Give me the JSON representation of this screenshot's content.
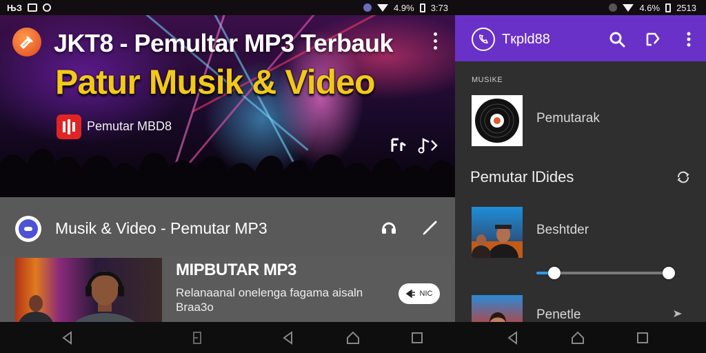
{
  "status_left": {
    "left_icons": [
      "sim-icon",
      "notification-icon",
      "media-icon"
    ],
    "left_text": "ЊЗ",
    "battery": "4.9%",
    "time": "3:73"
  },
  "status_right": {
    "battery": "4.6%",
    "time": "2513"
  },
  "banner": {
    "title": "JKT8 - Pemultar MP3 Terbauk",
    "subtitle": "Patur Musik & Video",
    "badge_label": "Pemutar MBD8"
  },
  "card": {
    "row_title": "Musik & Video - Pemutar MP3",
    "title": "MIPBUTAR MP3",
    "description": "Relanaanal onelenga fagama aisaln Braa3o",
    "pill_label": "NIC"
  },
  "right_pane": {
    "app_title": "Tкpld88",
    "section_caption": "MUSIKE",
    "items": [
      {
        "label": "Pemutarak"
      },
      {
        "label": "Beshtder"
      },
      {
        "label": "Penetle"
      }
    ],
    "section_head": "Pemutar lDides",
    "slider": {
      "value": 0.1,
      "range_end": 0.96
    }
  },
  "colors": {
    "appbar": "#6a31c8",
    "accent_yellow": "#f2c81a",
    "badge_red": "#e02424",
    "slider_blue": "#2d9cf0"
  }
}
